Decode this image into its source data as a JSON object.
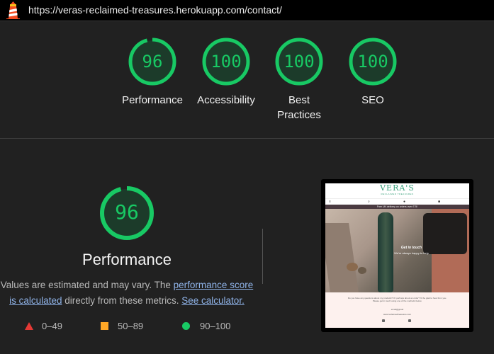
{
  "header": {
    "url": "https://veras-reclaimed-treasures.herokuapp.com/contact/",
    "icon": "lighthouse-icon"
  },
  "summary": {
    "categories": [
      {
        "score": "96",
        "label": "Performance"
      },
      {
        "score": "100",
        "label": "Accessibility"
      },
      {
        "score": "100",
        "label": "Best Practices"
      },
      {
        "score": "100",
        "label": "SEO"
      }
    ]
  },
  "performance": {
    "score": "96",
    "title": "Performance",
    "desc_before": "Values are estimated and may vary. The ",
    "link_score": "performance score is calculated",
    "desc_middle": " directly from these metrics. ",
    "link_calc": "See calculator.",
    "legend": [
      {
        "range": "0–49",
        "shape": "triangle",
        "color": "#e53935"
      },
      {
        "range": "50–89",
        "shape": "square",
        "color": "#ffa726"
      },
      {
        "range": "90–100",
        "shape": "circle",
        "color": "#18c964"
      }
    ]
  },
  "screenshot": {
    "brand": "VERA'S",
    "brand_sub": "RECLAIMED TREASURES",
    "banner": "Free UK delivery on orders over £75!",
    "hero_title": "Get in touch",
    "hero_sub": "We're always happy to help",
    "body_text": "Do you have any questions about my products? Or perhaps about an order? I'd be glad to hear from you. Please get in touch using one of the methods below.",
    "contact_email": "email@gmail",
    "contact_web": "www.reclaimedtreasures.com"
  },
  "colors": {
    "background": "#212121",
    "pass": "#18c964",
    "average": "#ffa726",
    "fail": "#e53935",
    "link": "#8fb3e8"
  }
}
